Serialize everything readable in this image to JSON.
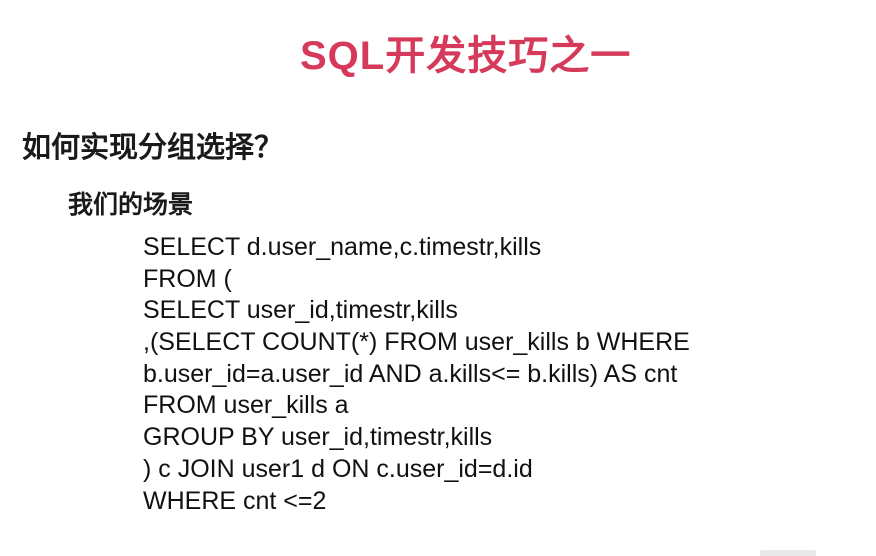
{
  "slide": {
    "title": "SQL开发技巧之一",
    "heading": "如何实现分组选择？",
    "subheading": "我们的场景",
    "code_lines": [
      "SELECT d.user_name,c.timestr,kills",
      "FROM (",
      "SELECT user_id,timestr,kills",
      ",(SELECT COUNT(*) FROM user_kills b WHERE",
      "b.user_id=a.user_id AND a.kills<= b.kills) AS cnt",
      "FROM user_kills a",
      "GROUP BY user_id,timestr,kills",
      ") c JOIN user1 d ON c.user_id=d.id",
      "WHERE cnt <=2"
    ]
  },
  "colors": {
    "title": "#d63a5a",
    "text": "#111111",
    "background": "#ffffff"
  }
}
